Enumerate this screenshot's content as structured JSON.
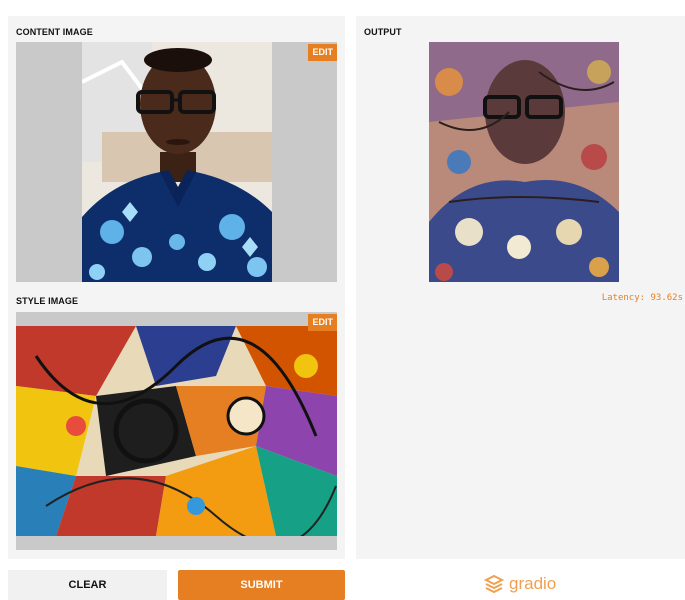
{
  "colors": {
    "accent": "#e67e22",
    "panel": "#f4f4f4",
    "image_bg": "#c9c9c9"
  },
  "inputs": {
    "content": {
      "label": "CONTENT IMAGE",
      "edit_label": "EDIT"
    },
    "style": {
      "label": "STYLE IMAGE",
      "edit_label": "EDIT"
    }
  },
  "output": {
    "label": "OUTPUT",
    "latency": "Latency: 93.62s"
  },
  "buttons": {
    "clear": "CLEAR",
    "submit": "SUBMIT"
  },
  "footer": {
    "brand": "gradio",
    "logo_icon": "gradio-logo-icon"
  }
}
